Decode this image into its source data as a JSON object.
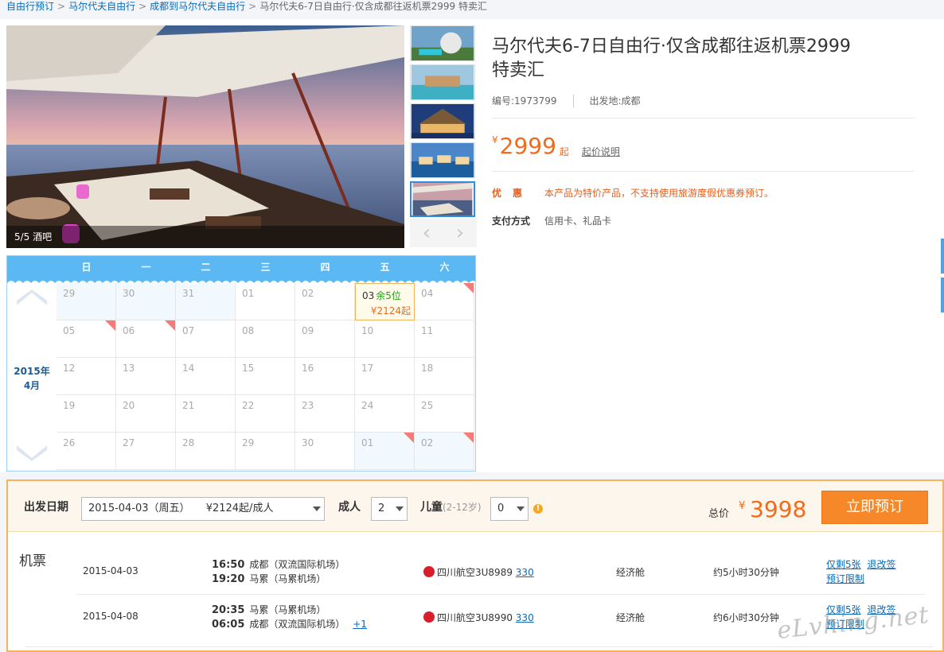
{
  "breadcrumb": [
    {
      "label": "自由行预订",
      "link": true
    },
    {
      "label": "马尔代夫自由行",
      "link": true
    },
    {
      "label": "成都到马尔代夫自由行",
      "link": true
    },
    {
      "label": "马尔代夫6-7日自由行·仅含成都往返机票2999 特卖汇",
      "link": false
    }
  ],
  "breadcrumb_sep": ">",
  "gallery": {
    "caption": "5/5 酒吧",
    "thumb_count": 5,
    "active_index": 4,
    "prev_icon": "‹",
    "next_icon": "›"
  },
  "product": {
    "title_line1": "马尔代夫6-7日自由行·仅含成都往返机票2999",
    "title_line2": "特卖汇",
    "code_label": "编号:",
    "code": "1973799",
    "origin_label": "出发地:",
    "origin": "成都",
    "currency": "¥",
    "price": "2999",
    "price_suffix": "起",
    "price_note": "起价说明",
    "promo_label": "优惠",
    "promo_text": "本产品为特价产品，不支持使用旅游度假优惠券预订。",
    "pay_label": "支付方式",
    "pay_text": "信用卡、礼品卡"
  },
  "calendar": {
    "weekdays": [
      "日",
      "一",
      "二",
      "三",
      "四",
      "五",
      "六"
    ],
    "year_month_line1": "2015年",
    "year_month_line2": "4月",
    "weeks": [
      [
        "29",
        "30",
        "31",
        "01",
        "02",
        "03",
        "04"
      ],
      [
        "05",
        "06",
        "07",
        "08",
        "09",
        "10",
        "11"
      ],
      [
        "12",
        "13",
        "14",
        "15",
        "16",
        "17",
        "18"
      ],
      [
        "19",
        "20",
        "21",
        "22",
        "23",
        "24",
        "25"
      ],
      [
        "26",
        "27",
        "28",
        "29",
        "30",
        "01",
        "02"
      ]
    ],
    "other_month": [
      [
        0,
        0
      ],
      [
        0,
        1
      ],
      [
        0,
        2
      ],
      [
        4,
        5
      ],
      [
        4,
        6
      ]
    ],
    "corner_tags": [
      [
        0,
        6
      ],
      [
        1,
        0
      ],
      [
        1,
        1
      ],
      [
        4,
        5
      ],
      [
        4,
        6
      ]
    ],
    "selected": {
      "row": 0,
      "col": 5,
      "remain": "余5位",
      "price": "¥2124起"
    }
  },
  "booking": {
    "date_label": "出发日期",
    "date_value": "2015-04-03（周五）",
    "date_price": "¥2124起/成人",
    "adult_label": "成人",
    "adult_value": "2",
    "child_label": "儿童",
    "child_hint": "(2-12岁)",
    "child_value": "0",
    "warn_icon": "!",
    "total_label": "总价",
    "total_currency": "¥",
    "total_value": "3998",
    "book_button": "立即预订"
  },
  "flights": {
    "section_label": "机票",
    "rows": [
      {
        "date": "2015-04-03",
        "dep_time": "16:50",
        "dep_airport": "成都（双流国际机场）",
        "arr_time": "19:20",
        "arr_airport": "马累（马累机场）",
        "plus_day": "",
        "airline": "四川航空3U8989",
        "aircraft": "330",
        "cabin": "经济舱",
        "duration": "约5小时30分钟",
        "tickets": "仅剩5张",
        "refund": "退改签",
        "limit": "预订限制"
      },
      {
        "date": "2015-04-08",
        "dep_time": "20:35",
        "dep_airport": "马累（马累机场）",
        "arr_time": "06:05",
        "arr_airport": "成都（双流国际机场）",
        "plus_day": "+1",
        "airline": "四川航空3U8990",
        "aircraft": "330",
        "cabin": "经济舱",
        "duration": "约6小时30分钟",
        "tickets": "仅剩5张",
        "refund": "退改签",
        "limit": "预订限制"
      }
    ]
  },
  "watermark": "eLvhing.net",
  "colors": {
    "accent": "#f06b1e",
    "link": "#0a6ab8",
    "calendar_head": "#5bb8f2",
    "button": "#f7882a"
  }
}
